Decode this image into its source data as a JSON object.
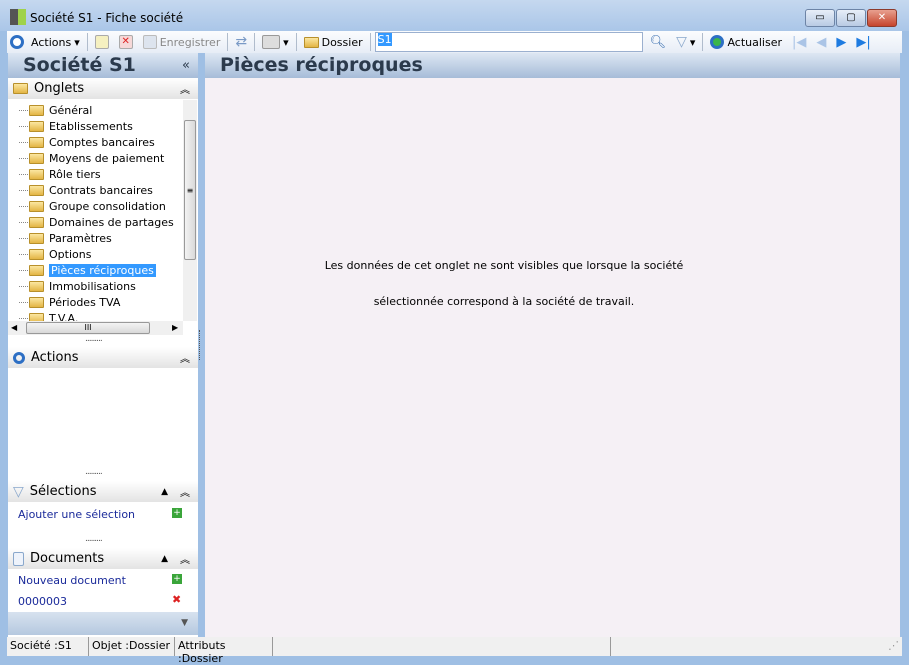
{
  "window": {
    "title": "Société S1 -  Fiche société",
    "minimize": "▭",
    "maximize": "▢",
    "close": "✕"
  },
  "toolbar": {
    "actions": "Actions",
    "save": "Enregistrer",
    "dossier": "Dossier",
    "search_value": "S1",
    "refresh": "Actualiser"
  },
  "left": {
    "title": "Société S1",
    "collapse": "«",
    "onglets": {
      "label": "Onglets",
      "items": [
        "Général",
        "Etablissements",
        "Comptes bancaires",
        "Moyens de paiement",
        "Rôle tiers",
        "Contrats bancaires",
        "Groupe consolidation",
        "Domaines de partages",
        "Paramètres",
        "Options",
        "Pièces réciproques",
        "Immobilisations",
        "Périodes TVA",
        "T.V.A."
      ],
      "selected": "Pièces réciproques"
    },
    "actions": {
      "label": "Actions"
    },
    "selections": {
      "label": "Sélections",
      "add": "Ajouter une sélection"
    },
    "documents": {
      "label": "Documents",
      "new": "Nouveau document",
      "items": [
        "0000003"
      ]
    }
  },
  "main": {
    "title": "Pièces réciproques",
    "message_line1": "Les données de cet onglet ne sont visibles que lorsque la société",
    "message_line2": "sélectionnée correspond à la société de travail."
  },
  "status": {
    "societe": "Société :S1",
    "objet": "Objet :Dossier",
    "attributs": "Attributs :Dossier"
  }
}
